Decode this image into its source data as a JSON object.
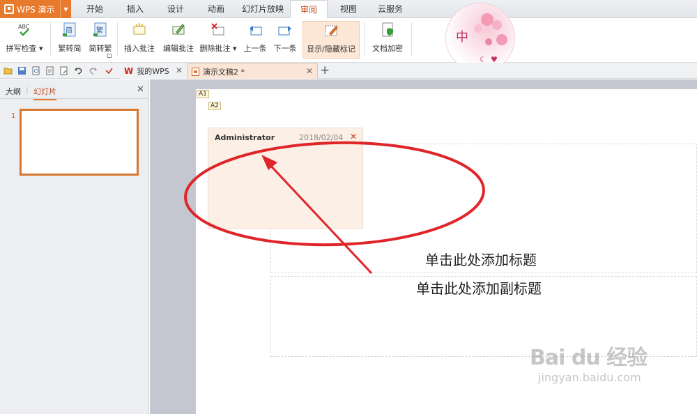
{
  "app": {
    "name": "WPS 演示"
  },
  "menu": [
    "开始",
    "插入",
    "设计",
    "动画",
    "幻灯片放映",
    "审阅",
    "视图",
    "云服务"
  ],
  "ribbon": {
    "spell": "拼写检查",
    "abc": "ABC",
    "trad": "繁转简",
    "simp": "简转繁",
    "insert_comment": "插入批注",
    "edit_comment": "编辑批注",
    "delete_comment": "删除批注",
    "prev": "上一条",
    "next": "下一条",
    "show_hide": "显示/隐藏标记",
    "encrypt": "文档加密",
    "trad_glyph": "简",
    "simp_glyph": "繁"
  },
  "deco": {
    "char": "中"
  },
  "doc_tabs": [
    "我的WPS",
    "演示文稿2 *"
  ],
  "left_pane": {
    "tab_outline": "大纲",
    "tab_slides": "幻灯片",
    "slide_num": "1"
  },
  "slide": {
    "marker_a1": "A1",
    "marker_a2": "A2",
    "comment_author": "Administrator",
    "comment_date": "2018/02/04",
    "title_placeholder": "单击此处添加标题",
    "subtitle_placeholder": "单击此处添加副标题"
  },
  "watermark": {
    "main": "Bai du 经验",
    "sub": "jingyan.baidu.com"
  },
  "colors": {
    "accent": "#e87a2e",
    "annotation": "#e0252a",
    "comment_bg": "#fbefe6"
  }
}
